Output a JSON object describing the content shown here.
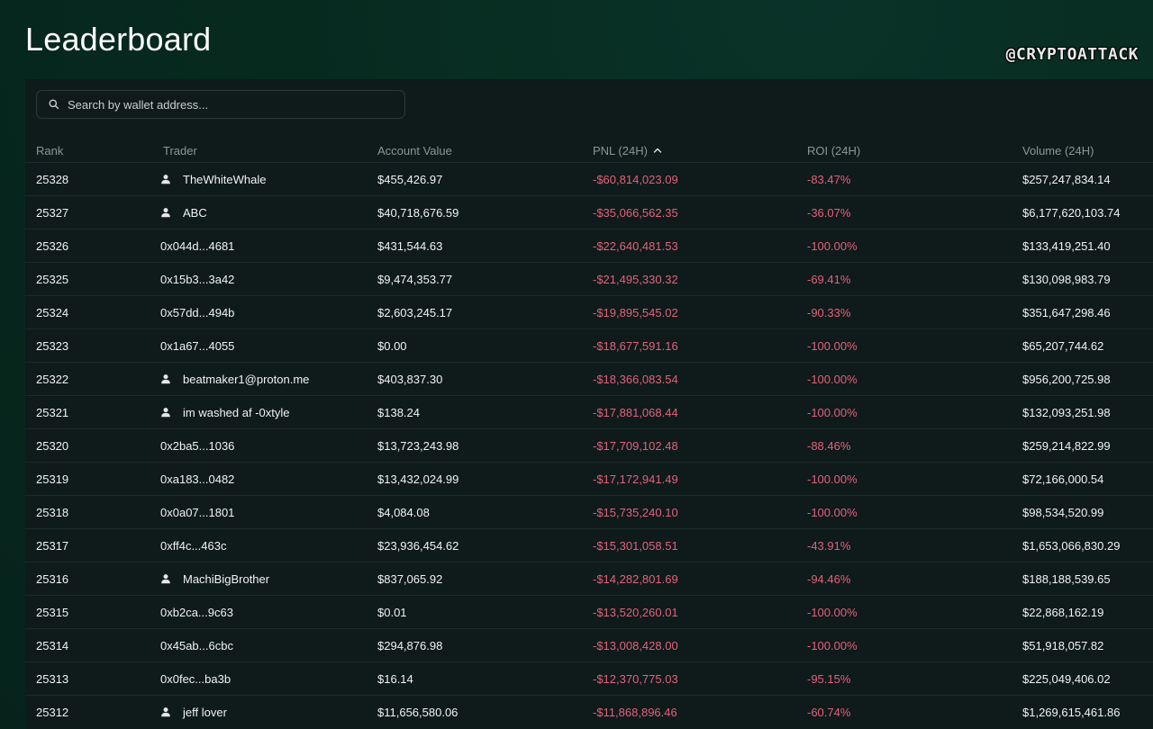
{
  "page": {
    "title": "Leaderboard",
    "watermark": "@CRYPTOATTACK"
  },
  "search": {
    "placeholder": "Search by wallet address...",
    "icon": "search-icon"
  },
  "columns": {
    "rank": "Rank",
    "trader": "Trader",
    "account_value": "Account Value",
    "pnl": "PNL (24H)",
    "roi": "ROI (24H)",
    "volume": "Volume (24H)",
    "sort_icon": "chevron-up-icon"
  },
  "colors": {
    "background": "#062a20",
    "panel": "#0f1a1b",
    "negative": "#e3627a",
    "header_text": "#8b9696",
    "text": "#f1f3f3"
  },
  "rows": [
    {
      "rank": "25328",
      "trader": "TheWhiteWhale",
      "has_icon": true,
      "account_value": "$455,426.97",
      "pnl": "-$60,814,023.09",
      "roi": "-83.47%",
      "volume": "$257,247,834.14"
    },
    {
      "rank": "25327",
      "trader": "ABC",
      "has_icon": true,
      "account_value": "$40,718,676.59",
      "pnl": "-$35,066,562.35",
      "roi": "-36.07%",
      "volume": "$6,177,620,103.74"
    },
    {
      "rank": "25326",
      "trader": "0x044d...4681",
      "has_icon": false,
      "account_value": "$431,544.63",
      "pnl": "-$22,640,481.53",
      "roi": "-100.00%",
      "volume": "$133,419,251.40"
    },
    {
      "rank": "25325",
      "trader": "0x15b3...3a42",
      "has_icon": false,
      "account_value": "$9,474,353.77",
      "pnl": "-$21,495,330.32",
      "roi": "-69.41%",
      "volume": "$130,098,983.79"
    },
    {
      "rank": "25324",
      "trader": "0x57dd...494b",
      "has_icon": false,
      "account_value": "$2,603,245.17",
      "pnl": "-$19,895,545.02",
      "roi": "-90.33%",
      "volume": "$351,647,298.46"
    },
    {
      "rank": "25323",
      "trader": "0x1a67...4055",
      "has_icon": false,
      "account_value": "$0.00",
      "pnl": "-$18,677,591.16",
      "roi": "-100.00%",
      "volume": "$65,207,744.62"
    },
    {
      "rank": "25322",
      "trader": "beatmaker1@proton.me",
      "has_icon": true,
      "account_value": "$403,837.30",
      "pnl": "-$18,366,083.54",
      "roi": "-100.00%",
      "volume": "$956,200,725.98"
    },
    {
      "rank": "25321",
      "trader": "im washed af -0xtyle",
      "has_icon": true,
      "account_value": "$138.24",
      "pnl": "-$17,881,068.44",
      "roi": "-100.00%",
      "volume": "$132,093,251.98"
    },
    {
      "rank": "25320",
      "trader": "0x2ba5...1036",
      "has_icon": false,
      "account_value": "$13,723,243.98",
      "pnl": "-$17,709,102.48",
      "roi": "-88.46%",
      "volume": "$259,214,822.99"
    },
    {
      "rank": "25319",
      "trader": "0xa183...0482",
      "has_icon": false,
      "account_value": "$13,432,024.99",
      "pnl": "-$17,172,941.49",
      "roi": "-100.00%",
      "volume": "$72,166,000.54"
    },
    {
      "rank": "25318",
      "trader": "0x0a07...1801",
      "has_icon": false,
      "account_value": "$4,084.08",
      "pnl": "-$15,735,240.10",
      "roi": "-100.00%",
      "volume": "$98,534,520.99"
    },
    {
      "rank": "25317",
      "trader": "0xff4c...463c",
      "has_icon": false,
      "account_value": "$23,936,454.62",
      "pnl": "-$15,301,058.51",
      "roi": "-43.91%",
      "volume": "$1,653,066,830.29"
    },
    {
      "rank": "25316",
      "trader": "MachiBigBrother",
      "has_icon": true,
      "account_value": "$837,065.92",
      "pnl": "-$14,282,801.69",
      "roi": "-94.46%",
      "volume": "$188,188,539.65"
    },
    {
      "rank": "25315",
      "trader": "0xb2ca...9c63",
      "has_icon": false,
      "account_value": "$0.01",
      "pnl": "-$13,520,260.01",
      "roi": "-100.00%",
      "volume": "$22,868,162.19"
    },
    {
      "rank": "25314",
      "trader": "0x45ab...6cbc",
      "has_icon": false,
      "account_value": "$294,876.98",
      "pnl": "-$13,008,428.00",
      "roi": "-100.00%",
      "volume": "$51,918,057.82"
    },
    {
      "rank": "25313",
      "trader": "0x0fec...ba3b",
      "has_icon": false,
      "account_value": "$16.14",
      "pnl": "-$12,370,775.03",
      "roi": "-95.15%",
      "volume": "$225,049,406.02"
    },
    {
      "rank": "25312",
      "trader": "jeff lover",
      "has_icon": true,
      "account_value": "$11,656,580.06",
      "pnl": "-$11,868,896.46",
      "roi": "-60.74%",
      "volume": "$1,269,615,461.86"
    }
  ]
}
